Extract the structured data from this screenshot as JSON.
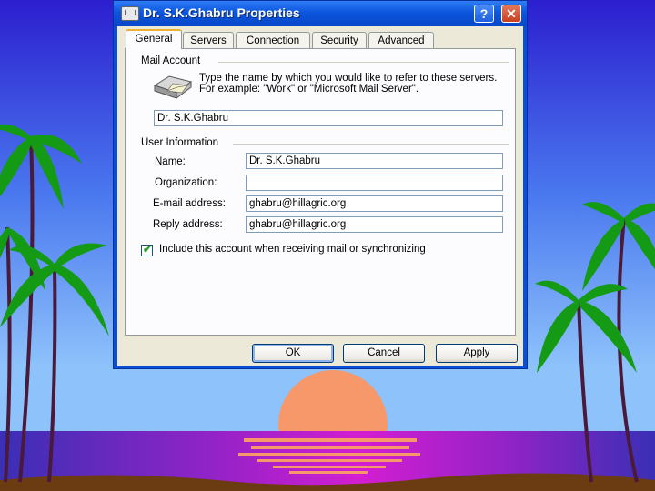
{
  "window": {
    "title": "Dr. S.K.Ghabru Properties",
    "help_glyph": "?",
    "close_glyph": "✕"
  },
  "tabs": [
    {
      "label": "General",
      "active": true
    },
    {
      "label": "Servers"
    },
    {
      "label": "Connection"
    },
    {
      "label": "Security"
    },
    {
      "label": "Advanced"
    }
  ],
  "mail_account": {
    "group_label": "Mail Account",
    "instructions": "Type the name by which you would like to refer to these servers.  For example: \"Work\" or \"Microsoft Mail Server\".",
    "account_name": "Dr. S.K.Ghabru"
  },
  "user_information": {
    "group_label": "User Information",
    "name_label": "Name:",
    "name_value": "Dr. S.K.Ghabru",
    "organization_label": "Organization:",
    "organization_value": "",
    "email_label": "E-mail address:",
    "email_value": "ghabru@hillagric.org",
    "reply_label": "Reply address:",
    "reply_value": "ghabru@hillagric.org"
  },
  "include_account": {
    "checked": true,
    "label": "Include this account when receiving mail or synchronizing"
  },
  "buttons": {
    "ok": "OK",
    "cancel": "Cancel",
    "apply": "Apply"
  }
}
